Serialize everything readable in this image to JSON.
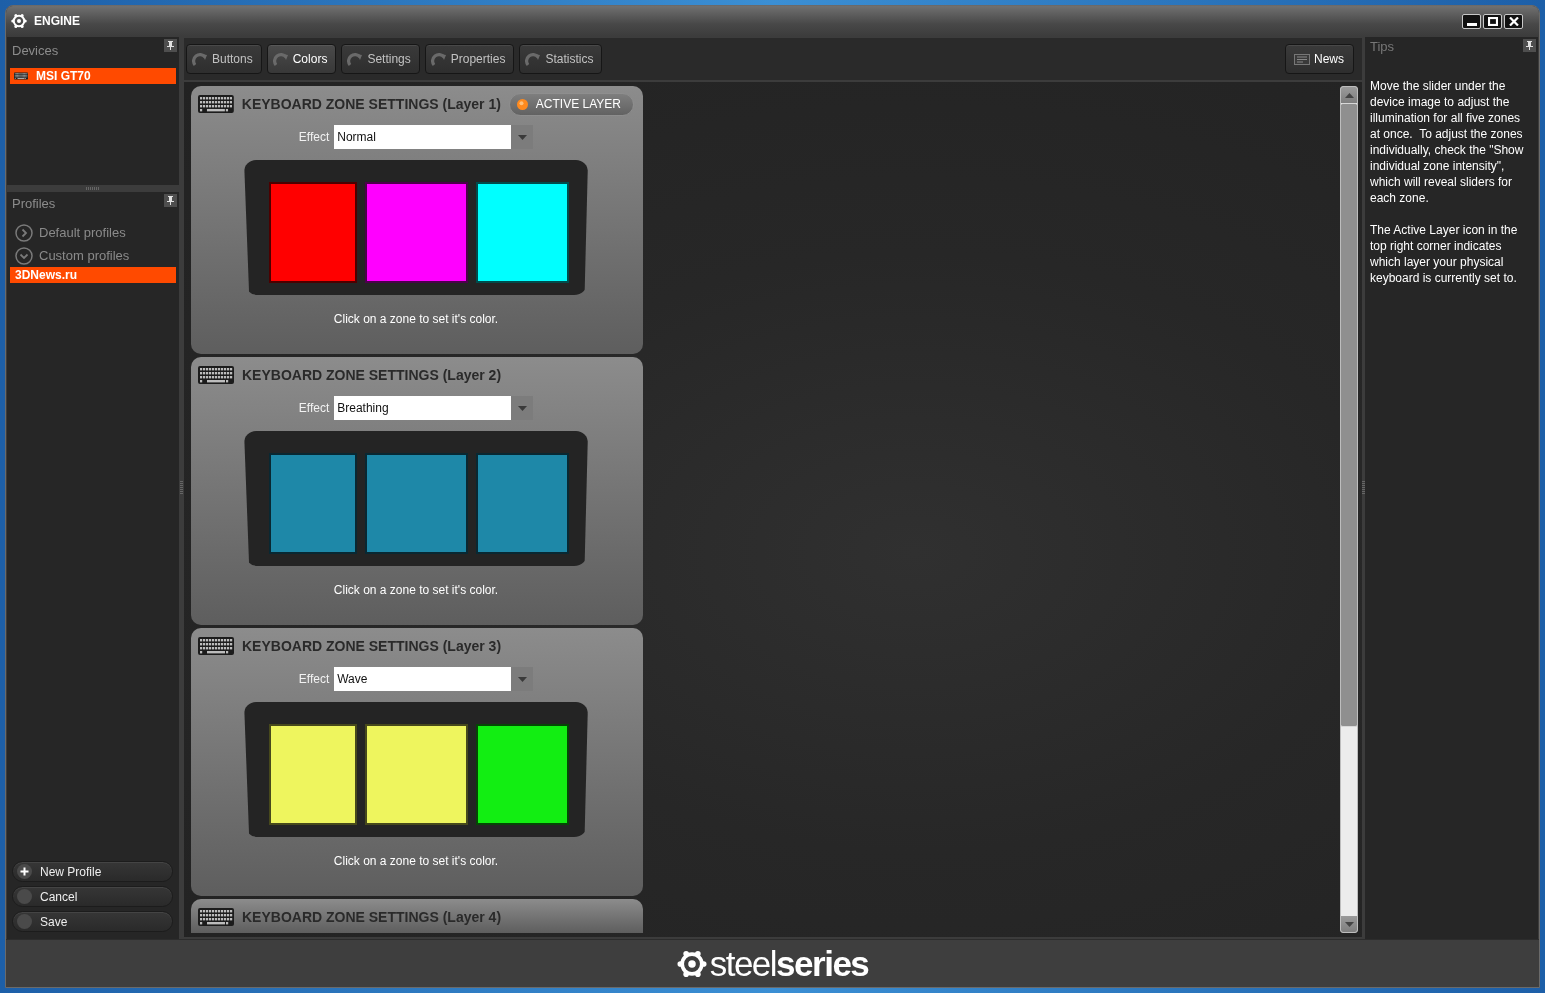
{
  "window": {
    "title": "ENGINE"
  },
  "sidebar": {
    "devices": {
      "title": "Devices",
      "items": [
        {
          "label": "MSI GT70",
          "selected": true
        }
      ]
    },
    "profiles": {
      "title": "Profiles",
      "groups": [
        {
          "label": "Default profiles",
          "expanded": false
        },
        {
          "label": "Custom profiles",
          "expanded": true,
          "children": [
            {
              "label": "3DNews.ru",
              "selected": true
            }
          ]
        }
      ]
    },
    "actions": [
      {
        "label": "New Profile",
        "kind": "add"
      },
      {
        "label": "Cancel",
        "kind": "plain"
      },
      {
        "label": "Save",
        "kind": "plain"
      }
    ]
  },
  "tabs": [
    {
      "label": "Buttons",
      "selected": false
    },
    {
      "label": "Colors",
      "selected": true
    },
    {
      "label": "Settings",
      "selected": false
    },
    {
      "label": "Properties",
      "selected": false
    },
    {
      "label": "Statistics",
      "selected": false
    }
  ],
  "news_button": {
    "label": "News"
  },
  "layers": [
    {
      "title": "KEYBOARD ZONE SETTINGS (Layer 1)",
      "active": true,
      "badge": "ACTIVE LAYER",
      "effect": {
        "label": "Effect",
        "value": "Normal"
      },
      "zones": [
        {
          "color": "#ff0000"
        },
        {
          "color": "#ff00ff"
        },
        {
          "color": "#00ffff"
        }
      ],
      "caption": "Click on a zone to set it's color."
    },
    {
      "title": "KEYBOARD ZONE SETTINGS (Layer 2)",
      "active": false,
      "effect": {
        "label": "Effect",
        "value": "Breathing"
      },
      "zones": [
        {
          "color": "#1e88a8"
        },
        {
          "color": "#1e88a8"
        },
        {
          "color": "#1e88a8"
        }
      ],
      "caption": "Click on a zone to set it's color."
    },
    {
      "title": "KEYBOARD ZONE SETTINGS (Layer 3)",
      "active": false,
      "effect": {
        "label": "Effect",
        "value": "Wave"
      },
      "zones": [
        {
          "color": "#eef55e"
        },
        {
          "color": "#eef55e"
        },
        {
          "color": "#12ee12"
        }
      ],
      "caption": "Click on a zone to set it's color."
    },
    {
      "title": "KEYBOARD ZONE SETTINGS (Layer 4)",
      "active": false
    }
  ],
  "tips": {
    "title": "Tips",
    "paragraphs": [
      "Move the slider under the device image to adjust the illumination for all five zones at once.  To adjust the zones individually, check the \"Show individual zone intensity\", which will reveal sliders for each zone.",
      "The Active Layer icon in the top right corner indicates which layer your physical keyboard is currently set to."
    ]
  },
  "footer": {
    "brand": "steel**series**"
  }
}
